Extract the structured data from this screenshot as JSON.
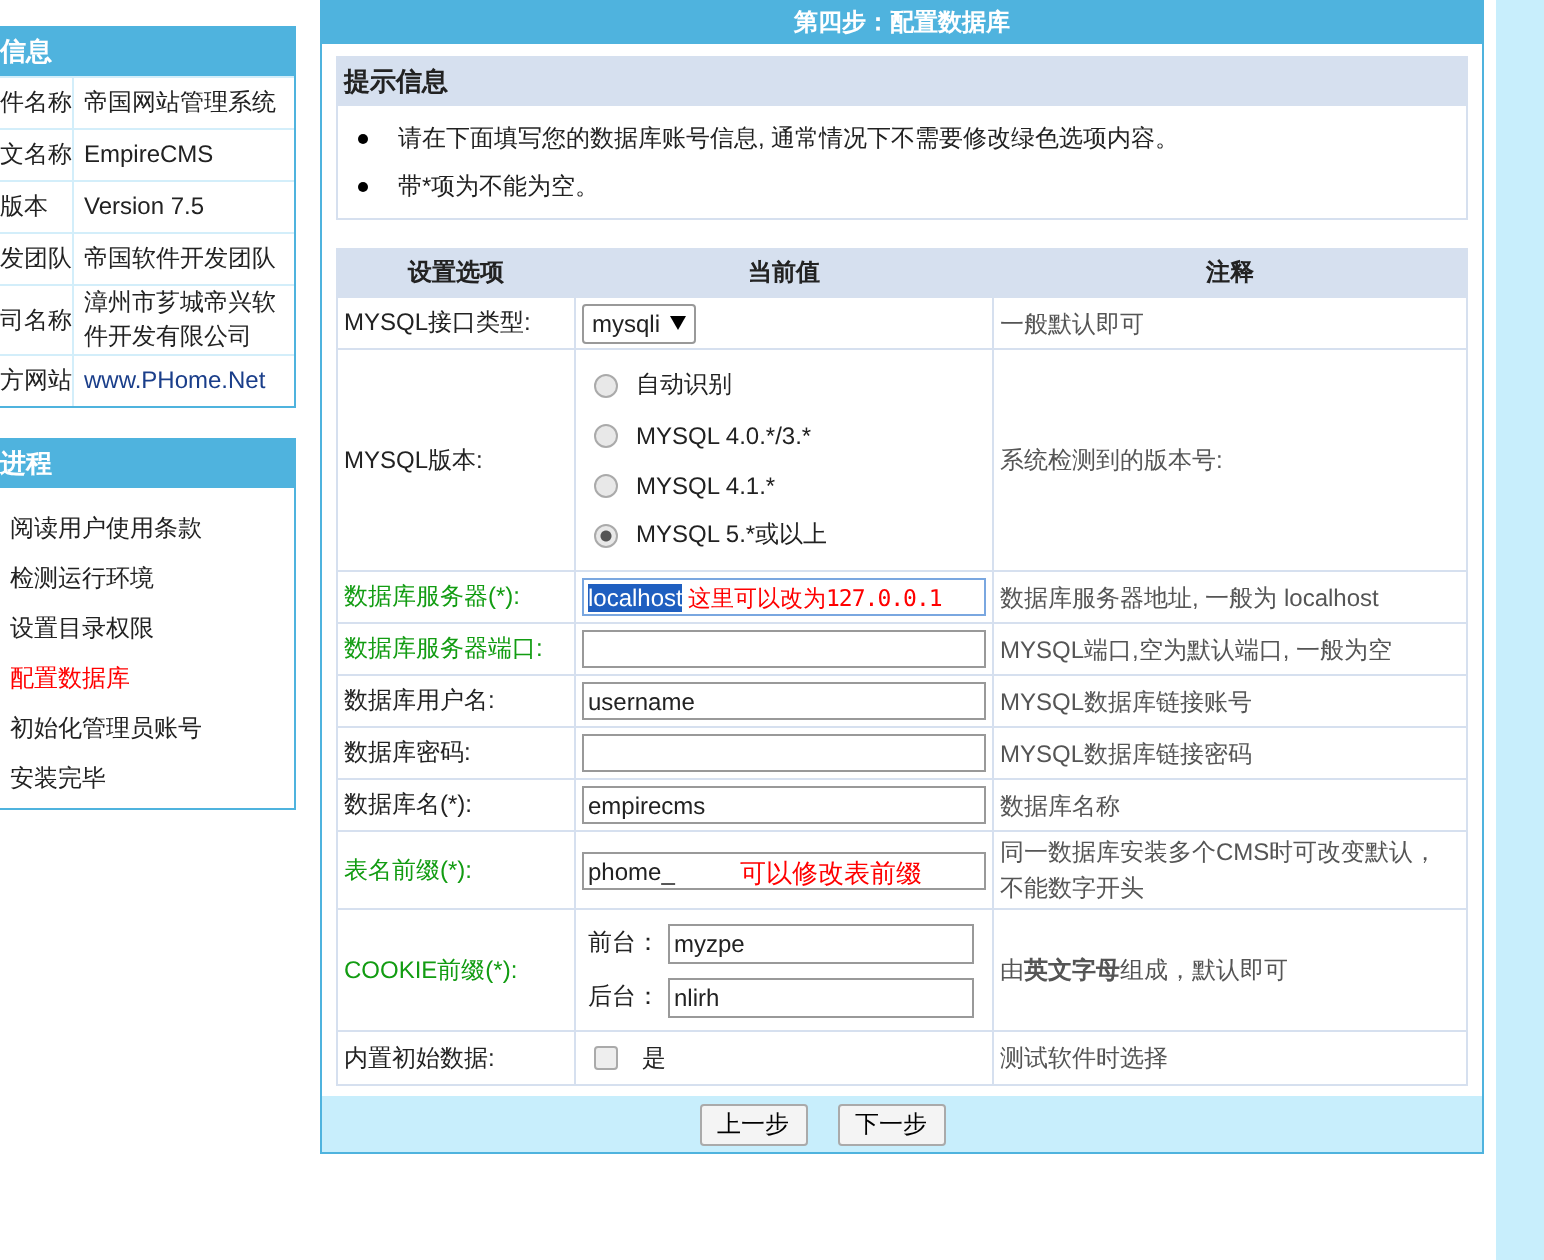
{
  "sidebar_panels": [
    {
      "title": "信息",
      "rows": [
        {
          "label": "件名称",
          "value": "帝国网站管理系统",
          "link": false
        },
        {
          "label": "文名称",
          "value": "EmpireCMS",
          "link": false
        },
        {
          "label": "版本",
          "value": "Version 7.5",
          "link": false
        },
        {
          "label": "发团队",
          "value": "帝国软件开发团队",
          "link": false
        },
        {
          "label": "司名称",
          "value": "漳州市芗城帝兴软件开发有限公司",
          "link": false
        },
        {
          "label": "方网站",
          "value": "www.PHome.Net",
          "link": true
        }
      ]
    },
    {
      "title": "进程",
      "steps": [
        {
          "label": "阅读用户使用条款",
          "selected": false
        },
        {
          "label": "检测运行环境",
          "selected": false
        },
        {
          "label": "设置目录权限",
          "selected": false
        },
        {
          "label": "配置数据库",
          "selected": true
        },
        {
          "label": "初始化管理员账号",
          "selected": false
        },
        {
          "label": "安装完毕",
          "selected": false
        }
      ]
    }
  ],
  "main": {
    "title": "第四步：配置数据库",
    "hint": {
      "title": "提示信息",
      "bullets": [
        "请在下面填写您的数据库账号信息, 通常情况下不需要修改绿色选项内容。",
        "带*项为不能为空。"
      ]
    },
    "table": {
      "columns": [
        "设置选项",
        "当前值",
        "注释"
      ],
      "rows": [
        {
          "kind": "select",
          "label": "MYSQL接口类型:",
          "default_option": false,
          "value": "mysqli",
          "note": "一般默认即可"
        },
        {
          "kind": "radio",
          "label": "MYSQL版本:",
          "default_option": false,
          "options": [
            {
              "label": "自动识别",
              "checked": false
            },
            {
              "label": "MYSQL 4.0.*/3.*",
              "checked": false
            },
            {
              "label": "MYSQL 4.1.*",
              "checked": false
            },
            {
              "label": "MYSQL 5.*或以上",
              "checked": true
            }
          ],
          "note": "系统检测到的版本号:"
        },
        {
          "kind": "text",
          "label": "数据库服务器(*):",
          "default_option": true,
          "value": "localhost",
          "value_highlighted": true,
          "annotation": "这里可以改为127.0.0.1",
          "note": "数据库服务器地址, 一般为 localhost"
        },
        {
          "kind": "text",
          "label": "数据库服务器端口:",
          "default_option": true,
          "note": "MYSQL端口,空为默认端口, 一般为空"
        },
        {
          "kind": "text",
          "label": "数据库用户名:",
          "default_option": false,
          "value": "username",
          "note": "MYSQL数据库链接账号"
        },
        {
          "kind": "text",
          "label": "数据库密码:",
          "default_option": false,
          "note": "MYSQL数据库链接密码"
        },
        {
          "kind": "text",
          "label": "数据库名(*):",
          "default_option": false,
          "value": "empirecms",
          "note": "数据库名称"
        },
        {
          "kind": "text",
          "label": "表名前缀(*):",
          "default_option": true,
          "value": "phome_",
          "annotation": "可以修改表前缀",
          "note": "同一数据库安装多个CMS时可改变默认，不能数字开头"
        },
        {
          "kind": "cookie",
          "label": "COOKIE前缀(*):",
          "default_option": true,
          "fields": [
            {
              "label": "前台：",
              "value": "myzpe"
            },
            {
              "label": "后台：",
              "value": "nlirh"
            }
          ],
          "note": "由**英文字母**组成，默认即可"
        },
        {
          "kind": "checkbox",
          "label": "内置初始数据:",
          "default_option": false,
          "checkbox": {
            "label": "是",
            "checked": false
          },
          "note": "测试软件时选择"
        }
      ]
    },
    "buttons": [
      "上一步",
      "下一步"
    ]
  }
}
